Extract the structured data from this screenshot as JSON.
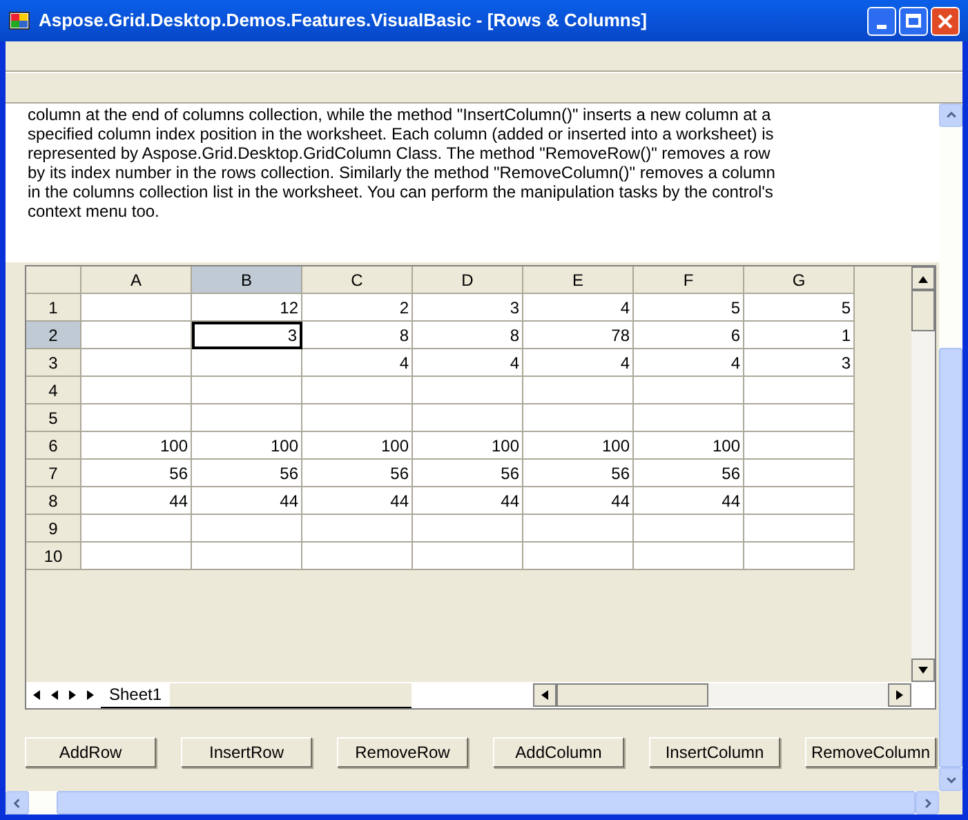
{
  "window": {
    "title": "Aspose.Grid.Desktop.Demos.Features.VisualBasic - [Rows & Columns]"
  },
  "description": "column at the end of columns collection, while the method \"InsertColumn()\" inserts a new column at a specified column index position in the worksheet. Each column (added or inserted into a worksheet) is represented by Aspose.Grid.Desktop.GridColumn Class. The method \"RemoveRow()\" removes a row by its index number in the rows collection. Similarly the method \"RemoveColumn()\" removes a column in the columns collection list in the worksheet. You can perform the manipulation tasks by the control's context menu too.",
  "grid": {
    "columns": [
      {
        "label": "A",
        "selected": false
      },
      {
        "label": "B",
        "selected": true
      },
      {
        "label": "C",
        "selected": false
      },
      {
        "label": "D",
        "selected": false
      },
      {
        "label": "E",
        "selected": false
      },
      {
        "label": "F",
        "selected": false
      },
      {
        "label": "G",
        "selected": false
      }
    ],
    "rows": [
      {
        "label": "1",
        "selected": false,
        "cells": [
          {
            "active": false
          },
          {
            "value": "12",
            "active": false
          },
          {
            "value": "2",
            "active": false
          },
          {
            "value": "3",
            "active": false
          },
          {
            "value": "4",
            "active": false
          },
          {
            "value": "5",
            "active": false
          },
          {
            "value": "5",
            "active": false
          }
        ]
      },
      {
        "label": "2",
        "selected": true,
        "cells": [
          {
            "active": false
          },
          {
            "value": "3",
            "active": true
          },
          {
            "value": "8",
            "active": false
          },
          {
            "value": "8",
            "active": false
          },
          {
            "value": "78",
            "active": false
          },
          {
            "value": "6",
            "active": false
          },
          {
            "value": "1",
            "active": false
          }
        ]
      },
      {
        "label": "3",
        "selected": false,
        "cells": [
          {
            "active": false
          },
          {
            "active": false
          },
          {
            "value": "4",
            "active": false
          },
          {
            "value": "4",
            "active": false
          },
          {
            "value": "4",
            "active": false
          },
          {
            "value": "4",
            "active": false
          },
          {
            "value": "3",
            "active": false
          }
        ]
      },
      {
        "label": "4",
        "selected": false,
        "cells": [
          {
            "active": false
          },
          {
            "active": false
          },
          {
            "active": false
          },
          {
            "active": false
          },
          {
            "active": false
          },
          {
            "active": false
          },
          {
            "active": false
          }
        ]
      },
      {
        "label": "5",
        "selected": false,
        "cells": [
          {
            "active": false
          },
          {
            "active": false
          },
          {
            "active": false
          },
          {
            "active": false
          },
          {
            "active": false
          },
          {
            "active": false
          },
          {
            "active": false
          }
        ]
      },
      {
        "label": "6",
        "selected": false,
        "cells": [
          {
            "value": "100",
            "active": false
          },
          {
            "value": "100",
            "active": false
          },
          {
            "value": "100",
            "active": false
          },
          {
            "value": "100",
            "active": false
          },
          {
            "value": "100",
            "active": false
          },
          {
            "value": "100",
            "active": false
          },
          {
            "active": false
          }
        ]
      },
      {
        "label": "7",
        "selected": false,
        "cells": [
          {
            "value": "56",
            "active": false
          },
          {
            "value": "56",
            "active": false
          },
          {
            "value": "56",
            "active": false
          },
          {
            "value": "56",
            "active": false
          },
          {
            "value": "56",
            "active": false
          },
          {
            "value": "56",
            "active": false
          },
          {
            "active": false
          }
        ]
      },
      {
        "label": "8",
        "selected": false,
        "cells": [
          {
            "value": "44",
            "active": false
          },
          {
            "value": "44",
            "active": false
          },
          {
            "value": "44",
            "active": false
          },
          {
            "value": "44",
            "active": false
          },
          {
            "value": "44",
            "active": false
          },
          {
            "value": "44",
            "active": false
          },
          {
            "active": false
          }
        ]
      },
      {
        "label": "9",
        "selected": false,
        "cells": [
          {
            "active": false
          },
          {
            "active": false
          },
          {
            "active": false
          },
          {
            "active": false
          },
          {
            "active": false
          },
          {
            "active": false
          },
          {
            "active": false
          }
        ]
      },
      {
        "label": "10",
        "selected": false,
        "cells": [
          {
            "active": false
          },
          {
            "active": false
          },
          {
            "active": false
          },
          {
            "active": false
          },
          {
            "active": false
          },
          {
            "active": false
          },
          {
            "active": false
          }
        ]
      }
    ],
    "sheet_tabs": [
      {
        "label": "Sheet1",
        "selected": true
      }
    ]
  },
  "buttons": [
    "AddRow",
    "InsertRow",
    "RemoveRow",
    "AddColumn",
    "InsertColumn",
    "RemoveColumn"
  ]
}
